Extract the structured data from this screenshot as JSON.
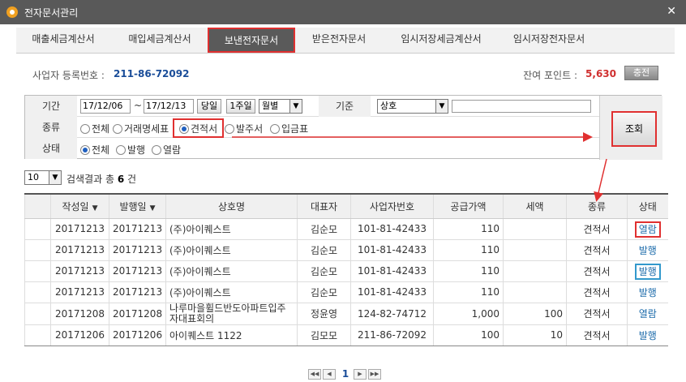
{
  "window": {
    "title": "전자문서관리"
  },
  "tabs": [
    {
      "label": "매출세금계산서"
    },
    {
      "label": "매입세금계산서"
    },
    {
      "label": "보낸전자문서"
    },
    {
      "label": "받은전자문서"
    },
    {
      "label": "임시저장세금계산서"
    },
    {
      "label": "임시저장전자문서"
    }
  ],
  "active_tab": 2,
  "header": {
    "reg_label": "사업자 등록번호 :",
    "reg_number": "211-86-72092",
    "points_label": "잔여 포인트 :",
    "points_value": "5,630",
    "charge_button": "충전"
  },
  "search": {
    "period_label": "기간",
    "date_from": "17/12/06",
    "tilde": "~",
    "date_to": "17/12/13",
    "today_button": "당일",
    "week_button": "1주일",
    "month_select": "월별",
    "basis_label": "기준",
    "basis_select": "상호",
    "basis_input": "",
    "type_label": "종류",
    "types": [
      "전체",
      "거래명세표",
      "견적서",
      "발주서",
      "입금표"
    ],
    "type_selected": 2,
    "status_label": "상태",
    "statuses": [
      "전체",
      "발행",
      "열람"
    ],
    "status_selected": 0,
    "search_button": "조회"
  },
  "results": {
    "page_size": "10",
    "summary_prefix": "검색결과 총",
    "count": "6",
    "summary_suffix": "건"
  },
  "table": {
    "headers": [
      "작성일",
      "발행일",
      "상호명",
      "대표자",
      "사업자번호",
      "공급가액",
      "세액",
      "종류",
      "상태"
    ],
    "rows": [
      {
        "write_date": "20171213",
        "issue_date": "20171213",
        "company": "(주)아이퀘스트",
        "ceo": "김순모",
        "biz_no": "101-81-42433",
        "supply": "110",
        "tax": "",
        "kind": "견적서",
        "status": "열람"
      },
      {
        "write_date": "20171213",
        "issue_date": "20171213",
        "company": "(주)아이퀘스트",
        "ceo": "김순모",
        "biz_no": "101-81-42433",
        "supply": "110",
        "tax": "",
        "kind": "견적서",
        "status": "발행"
      },
      {
        "write_date": "20171213",
        "issue_date": "20171213",
        "company": "(주)아이퀘스트",
        "ceo": "김순모",
        "biz_no": "101-81-42433",
        "supply": "110",
        "tax": "",
        "kind": "견적서",
        "status": "발행"
      },
      {
        "write_date": "20171213",
        "issue_date": "20171213",
        "company": "(주)아이퀘스트",
        "ceo": "김순모",
        "biz_no": "101-81-42433",
        "supply": "110",
        "tax": "",
        "kind": "견적서",
        "status": "발행"
      },
      {
        "write_date": "20171208",
        "issue_date": "20171208",
        "company": "나루마을휠드반도아파트입주자대표회의",
        "ceo": "정윤영",
        "biz_no": "124-82-74712",
        "supply": "1,000",
        "tax": "100",
        "kind": "견적서",
        "status": "열람"
      },
      {
        "write_date": "20171206",
        "issue_date": "20171206",
        "company": "아이퀘스트 1122",
        "ceo": "김모모",
        "biz_no": "211-86-72092",
        "supply": "100",
        "tax": "10",
        "kind": "견적서",
        "status": "발행"
      }
    ]
  },
  "pagination": {
    "current": "1"
  },
  "colors": {
    "highlight_red": "#e03030",
    "highlight_blue": "#3399cc",
    "link_blue": "#1a6aaa",
    "points_red": "#d03030"
  }
}
